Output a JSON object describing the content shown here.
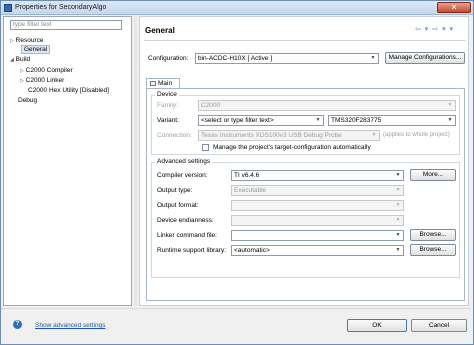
{
  "window": {
    "title": "Properties for SecondaryAlgo",
    "close_glyph": "✕"
  },
  "left": {
    "filter_placeholder": "type filter text",
    "tree": {
      "resource": "Resource",
      "general": "General",
      "build": "Build",
      "c2000_compiler": "C2000 Compiler",
      "c2000_linker": "C2000 Linker",
      "hex_utility": "C2000 Hex Utility  [Disabled]",
      "debug": "Debug"
    }
  },
  "header": {
    "title": "General",
    "nav_glyphs": "⇦ ▾ ⇨ ▾ ▾"
  },
  "config": {
    "label": "Configuration:",
    "value": "bin-ACDC-H10X  [ Active ]",
    "manage_button": "Manage Configurations..."
  },
  "tab": {
    "label": "Main"
  },
  "device": {
    "group_title": "Device",
    "family_label": "Family:",
    "family_value": "C2000",
    "variant_label": "Variant:",
    "variant_filter": "<select or type filter text>",
    "variant_value": "TMS320F283775",
    "connection_label": "Connection:",
    "connection_value": "Texas Instruments XDS100v3 USB Debug Probe",
    "connection_note": "(applies to whole project)",
    "manage_target_label": "Manage the project's target-configuration automatically"
  },
  "advanced": {
    "group_title": "Advanced settings",
    "compiler_label": "Compiler version:",
    "compiler_value": "TI v6.4.6",
    "more_button": "More...",
    "output_type_label": "Output type:",
    "output_type_value": "Executable",
    "output_format_label": "Output format:",
    "output_format_value": "",
    "endianness_label": "Device endianness:",
    "endianness_value": "",
    "linker_cmd_label": "Linker command file:",
    "linker_cmd_value": "",
    "browse_button": "Browse...",
    "runtime_lib_label": "Runtime support library:",
    "runtime_lib_value": "<automatic>",
    "browse_button_2": "Browse..."
  },
  "footer": {
    "help_glyph": "?",
    "show_advanced": "Show advanced settings",
    "ok": "OK",
    "cancel": "Cancel"
  }
}
